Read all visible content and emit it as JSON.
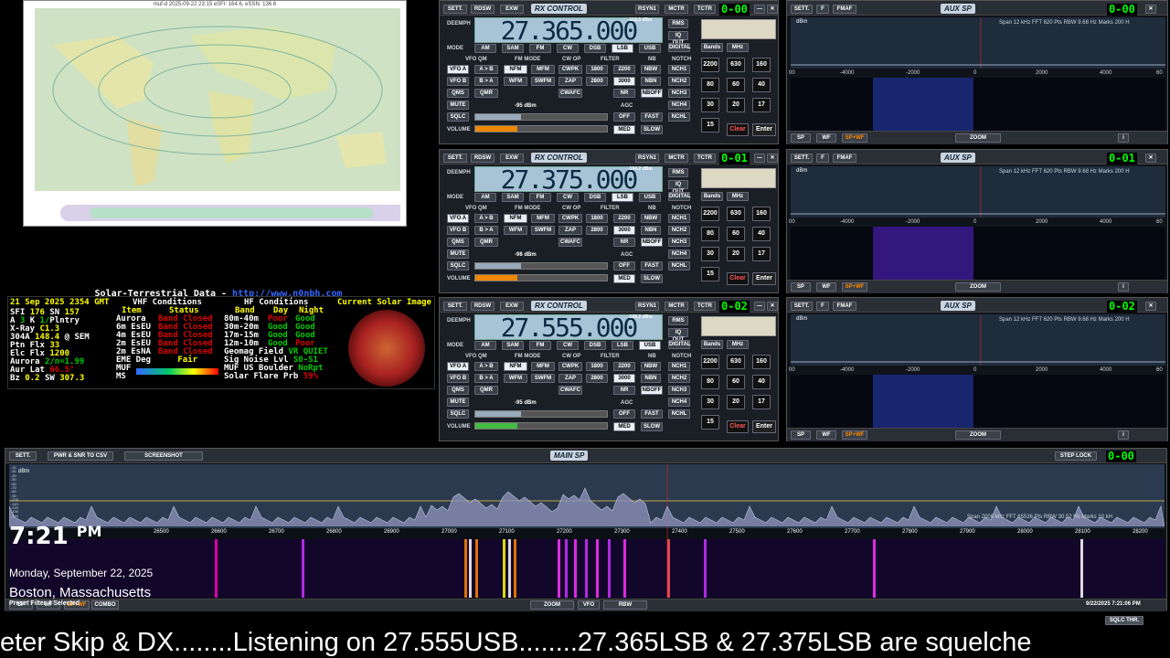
{
  "map": {
    "title": "muf-d 2025-09-22 23:15 eSFI: 164.6, eSSN: 136.6"
  },
  "solar": {
    "heading": "Solar-Terrestrial Data - ",
    "link": "http://www.n0nbh.com",
    "date": "21 Sep 2025 2354 GMT",
    "sfi_label": "SFI",
    "sfi": "176",
    "sn_label": "SN",
    "sn": "157",
    "a_label": "A",
    "a": "3",
    "k_label": "K",
    "k": "1/",
    "k_status": "Plntry",
    "xray_label": "X-Ray",
    "xray": "C1.3",
    "304a_label": "304A",
    "304a": "148.4",
    "304a_src": "@ SEM",
    "ptn_label": "Ptn Flx",
    "ptn": "33",
    "elc_label": "Elc Flx",
    "elc": "1200",
    "aurora_label": "Aurora",
    "aurora": "2/n=1.99",
    "aurlat_label": "Aur Lat",
    "aurlat": "66.5°",
    "bz_label": "Bz",
    "bz": "0.2",
    "sw_label": "SW",
    "sw": "307.3",
    "vhf_title": "VHF Conditions",
    "vhf_h_item": "Item",
    "vhf_h_status": "Status",
    "vhf": [
      {
        "item": "Aurora",
        "status": "Band Closed"
      },
      {
        "item": "6m EsEU",
        "status": "Band Closed"
      },
      {
        "item": "4m EsEU",
        "status": "Band Closed"
      },
      {
        "item": "2m EsEU",
        "status": "Band Closed"
      },
      {
        "item": "2m EsNA",
        "status": "Band Closed"
      }
    ],
    "eme_label": "EME Deg",
    "eme": "Fair",
    "muf_label": "MUF",
    "ms_label": "MS",
    "hf_title": "HF Conditions",
    "hf_h_band": "Band",
    "hf_h_day": "Day",
    "hf_h_night": "Night",
    "hf": [
      {
        "band": "80m-40m",
        "day": "Poor",
        "night": "Good"
      },
      {
        "band": "30m-20m",
        "day": "Good",
        "night": "Good"
      },
      {
        "band": "17m-15m",
        "day": "Good",
        "night": "Good"
      },
      {
        "band": "12m-10m",
        "day": "Good",
        "night": "Poor"
      }
    ],
    "geo_label": "Geomag Field",
    "geo": "VR QUIET",
    "noise_label": "Sig Noise Lvl",
    "noise": "S0-S1",
    "mufus_label": "MUF US Boulder",
    "mufus": "NoRpt",
    "flare_label": "Solar Flare Prb",
    "flare": "59%",
    "img_title": "Current Solar Image"
  },
  "rx": [
    {
      "freq": "27.365.000",
      "step": "STEP:",
      "step_val": "500 Hz",
      "dbm": "-119.3 dBm",
      "sq": "-95 dBm",
      "mode": "LSB",
      "clock": "0-00",
      "title": "RX CONTROL"
    },
    {
      "freq": "27.375.000",
      "step": "STEP:",
      "step_val": "500 Hz",
      "dbm": "-104.2 dBm",
      "sq": "-98 dBm",
      "mode": "LSB",
      "clock": "0-01",
      "title": "RX CONTROL"
    },
    {
      "freq": "27.555.000",
      "step": "STEP:",
      "step_val": "500 Hz",
      "dbm": "-126.2 dBm",
      "sq": "-95 dBm",
      "mode": "USB",
      "clock": "0-02",
      "title": "RX CONTROL"
    }
  ],
  "rxlabels": {
    "sett": "SETT.",
    "rdsw": "RDSW",
    "exw": "EXW",
    "rsyn": "RSYN1",
    "mctr": "MCTR",
    "tctr": "TCTR",
    "deemph": "DEEMPH",
    "rms": "RMS",
    "iqout": "IQ OUT",
    "digital": "DIGITAL",
    "mode": "MODE",
    "vfo": "VFO",
    "qm": "QM",
    "fmmode": "FM MODE",
    "cwop": "CW OP",
    "filter": "FILTER",
    "nb": "NB",
    "notch": "NOTCH",
    "am": "AM",
    "sam": "SAM",
    "fm": "FM",
    "cw": "CW",
    "dsb": "DSB",
    "lsb": "LSB",
    "usb": "USB",
    "vfoa": "VFO A",
    "vfob": "VFO B",
    "atob": "A > B",
    "btoa": "B > A",
    "qms": "QMS",
    "qmr": "QMR",
    "nfm": "NFM",
    "mfm": "MFM",
    "wfm": "WFM",
    "swfm": "SWFM",
    "cwpk": "CWPK",
    "zap": "ZAP",
    "cwafc": "CWAFC",
    "f1800": "1800",
    "f2200": "2200",
    "f2800": "2800",
    "f3000": "3000",
    "nbw": "NBW",
    "nbn": "NBN",
    "nr": "NR",
    "nboff": "NBOFF",
    "nch1": "NCH1",
    "nch2": "NCH2",
    "nch3": "NCH3",
    "nch4": "NCH4",
    "nchl": "NCHL",
    "mute": "MUTE",
    "sqlc": "SQLC",
    "volume": "VOLUME",
    "agc": "AGC",
    "off": "OFF",
    "fast": "FAST",
    "med": "MED",
    "slow": "SLOW",
    "bands": "Bands",
    "mhz": "MHz",
    "clear": "Clear",
    "enter": "Enter",
    "k2200": "2200",
    "k630": "630",
    "k160": "160",
    "k80": "80",
    "k60": "60",
    "k40": "40",
    "k30": "30",
    "k20": "20",
    "k17": "17",
    "k15": "15"
  },
  "aux": [
    {
      "clock": "0-00",
      "info": "Span 12 kHz   FFT 620 Pts   RBW 9.68 Hz   Marks 200 H"
    },
    {
      "clock": "0-01",
      "info": "Span 12 kHz   FFT 620 Pts   RBW 9.68 Hz   Marks 200 H"
    },
    {
      "clock": "0-02",
      "info": "Span 12 kHz   FFT 620 Pts   RBW 9.68 Hz   Marks 200 H"
    }
  ],
  "auxlabels": {
    "sett": "SETT.",
    "f": "F",
    "fmaf": "FMAF",
    "title": "AUX SP",
    "dbm": "dBm",
    "ticks": [
      "-4000",
      "-2000",
      "0",
      "2000",
      "4000",
      "60"
    ],
    "tick_left": "00",
    "sp": "SP",
    "wf": "WF",
    "spwf": "SP+WF",
    "zoom": "ZOOM",
    "info": "i"
  },
  "main": {
    "sett": "SETT.",
    "pwr": "PWR & SNR TO CSV",
    "screenshot": "SCREENSHOT",
    "title": "MAIN SP",
    "steplock": "STEP LOCK",
    "clock": "0-00",
    "dbm": "dBm",
    "info": "Span 2000 kHz   FFT 65536 Pts   RBW 30.52 Hz   Marks 10 kH",
    "ticks": [
      "26500",
      "26600",
      "26700",
      "26800",
      "26900",
      "27000",
      "27100",
      "27200",
      "27300",
      "27400",
      "27500",
      "27600",
      "27700",
      "27800",
      "27900",
      "28000",
      "28100",
      "28200"
    ],
    "yticks": [
      "-20",
      "-30",
      "-40",
      "-50",
      "-60",
      "-70",
      "-80",
      "-90",
      "-100",
      "-110",
      "-120",
      "-130",
      "-140"
    ],
    "sp": "SP",
    "wf": "WF",
    "spwf": "SP+WF",
    "combo": "COMBO",
    "zoom": "ZOOM",
    "vfo": "VFO",
    "rbw": "RBW",
    "timestamp": "9/22/2025 7:21:06 PM",
    "sqlc_thr": "SQLC THR."
  },
  "overlay": {
    "time": "7:21",
    "ampm": "PM",
    "date": "Monday, September 22, 2025",
    "place": "Boston, Massachusetts",
    "preset": "Preset Filter 4 Selected"
  },
  "ticker": "eter Skip & DX........Listening on 27.555USB........27.365LSB & 27.375LSB are squelche"
}
